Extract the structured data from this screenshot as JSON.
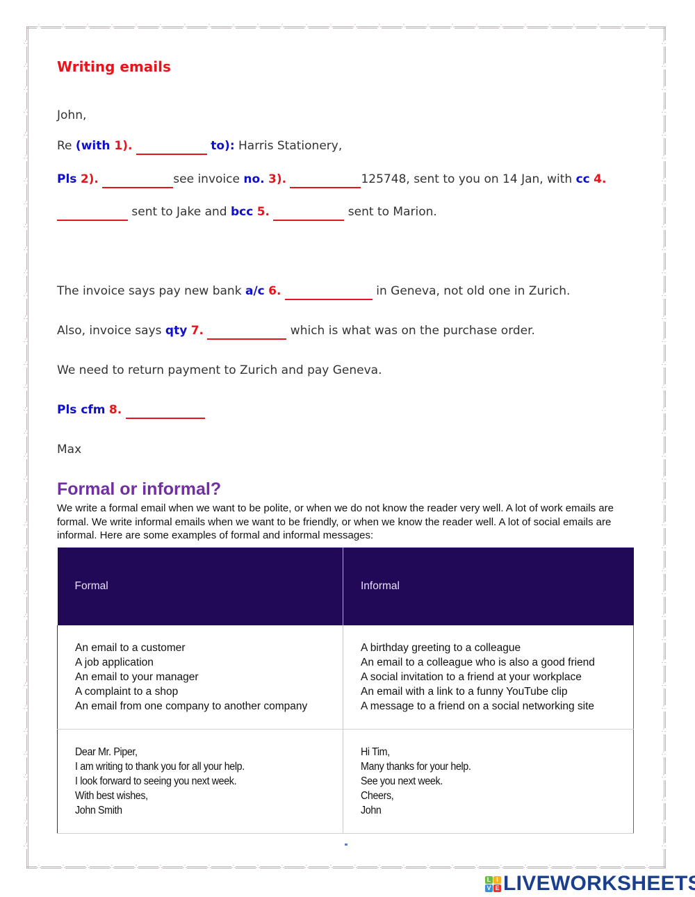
{
  "worksheet": {
    "title": "Writing emails",
    "email": {
      "greeting": "John,",
      "line_re": {
        "prefix": "Re ",
        "kw_open": "(with ",
        "num": "1).",
        "kw_close": "to):",
        "suffix": " Harris Stationery,"
      },
      "line_pls": {
        "kw1": "Pls",
        "num2": "2).",
        "mid": "see invoice ",
        "kw2": "no.",
        "num3": "3).",
        "suffix": "125748, sent to you on 14 Jan, with ",
        "kw3": "cc",
        "num4": "4."
      },
      "line_cc": {
        "text1": " sent to Jake and ",
        "kw": "bcc",
        "num5": "5.",
        "text2": " sent to Marion."
      },
      "line_bank": {
        "prefix": "The invoice says pay new bank ",
        "kw": "a/c",
        "num6": "6.",
        "suffix": " in Geneva, not old one in Zurich."
      },
      "line_qty": {
        "prefix": "Also, invoice says ",
        "kw": "qty",
        "num7": "7.",
        "suffix": " which is what was on the purchase order."
      },
      "line_return": "We need to return payment to Zurich and pay Geneva.",
      "line_cfm": {
        "kw": "Pls cfm",
        "num8": "8."
      },
      "signoff": "Max"
    },
    "blanks": {
      "1": "",
      "2": "",
      "3": "",
      "4": "",
      "5": "",
      "6": "",
      "7": "",
      "8": ""
    },
    "formal_section": {
      "heading": "Formal or informal?",
      "intro": "We write a formal email when we want to be polite, or when we do not know the reader very well. A lot of work emails are formal. We write informal emails when we want to be friendly, or when we know the reader well. A lot of social emails are informal. Here are some examples of formal and informal messages:",
      "table": {
        "headers": [
          "Formal",
          "Informal"
        ],
        "rows": [
          {
            "formal": [
              "An email to a customer",
              "A job application",
              "An email to your manager",
              "A complaint to a shop",
              "An email from one company to another company"
            ],
            "informal": [
              "A birthday greeting to a colleague",
              "An email to a colleague who is also a good friend",
              "A social invitation to a friend at your workplace",
              "An email with a link to a funny YouTube clip",
              "A message to a friend on a social networking site"
            ]
          },
          {
            "formal": [
              "Dear Mr. Piper,",
              "I am writing to thank you for all your help.",
              "I look forward to seeing you next week.",
              "With best wishes,",
              "John Smith"
            ],
            "informal": [
              "Hi Tim,",
              "Many thanks for your help.",
              "See you next week.",
              "Cheers,",
              "John"
            ]
          }
        ]
      }
    }
  },
  "branding": {
    "logo_tiles": [
      "L",
      "I",
      "V",
      "E"
    ],
    "logo_tile_colors": [
      "#6cbf3e",
      "#f5b21c",
      "#3a8fd8",
      "#e8332a"
    ],
    "logo_word": "LIVEWORKSHEETS"
  },
  "colors": {
    "title_red": "#e8141b",
    "keyword_blue": "#1010c8",
    "heading_purple": "#7030a0",
    "table_header_bg": "#210957",
    "logo_blue": "#1b3f8f"
  }
}
